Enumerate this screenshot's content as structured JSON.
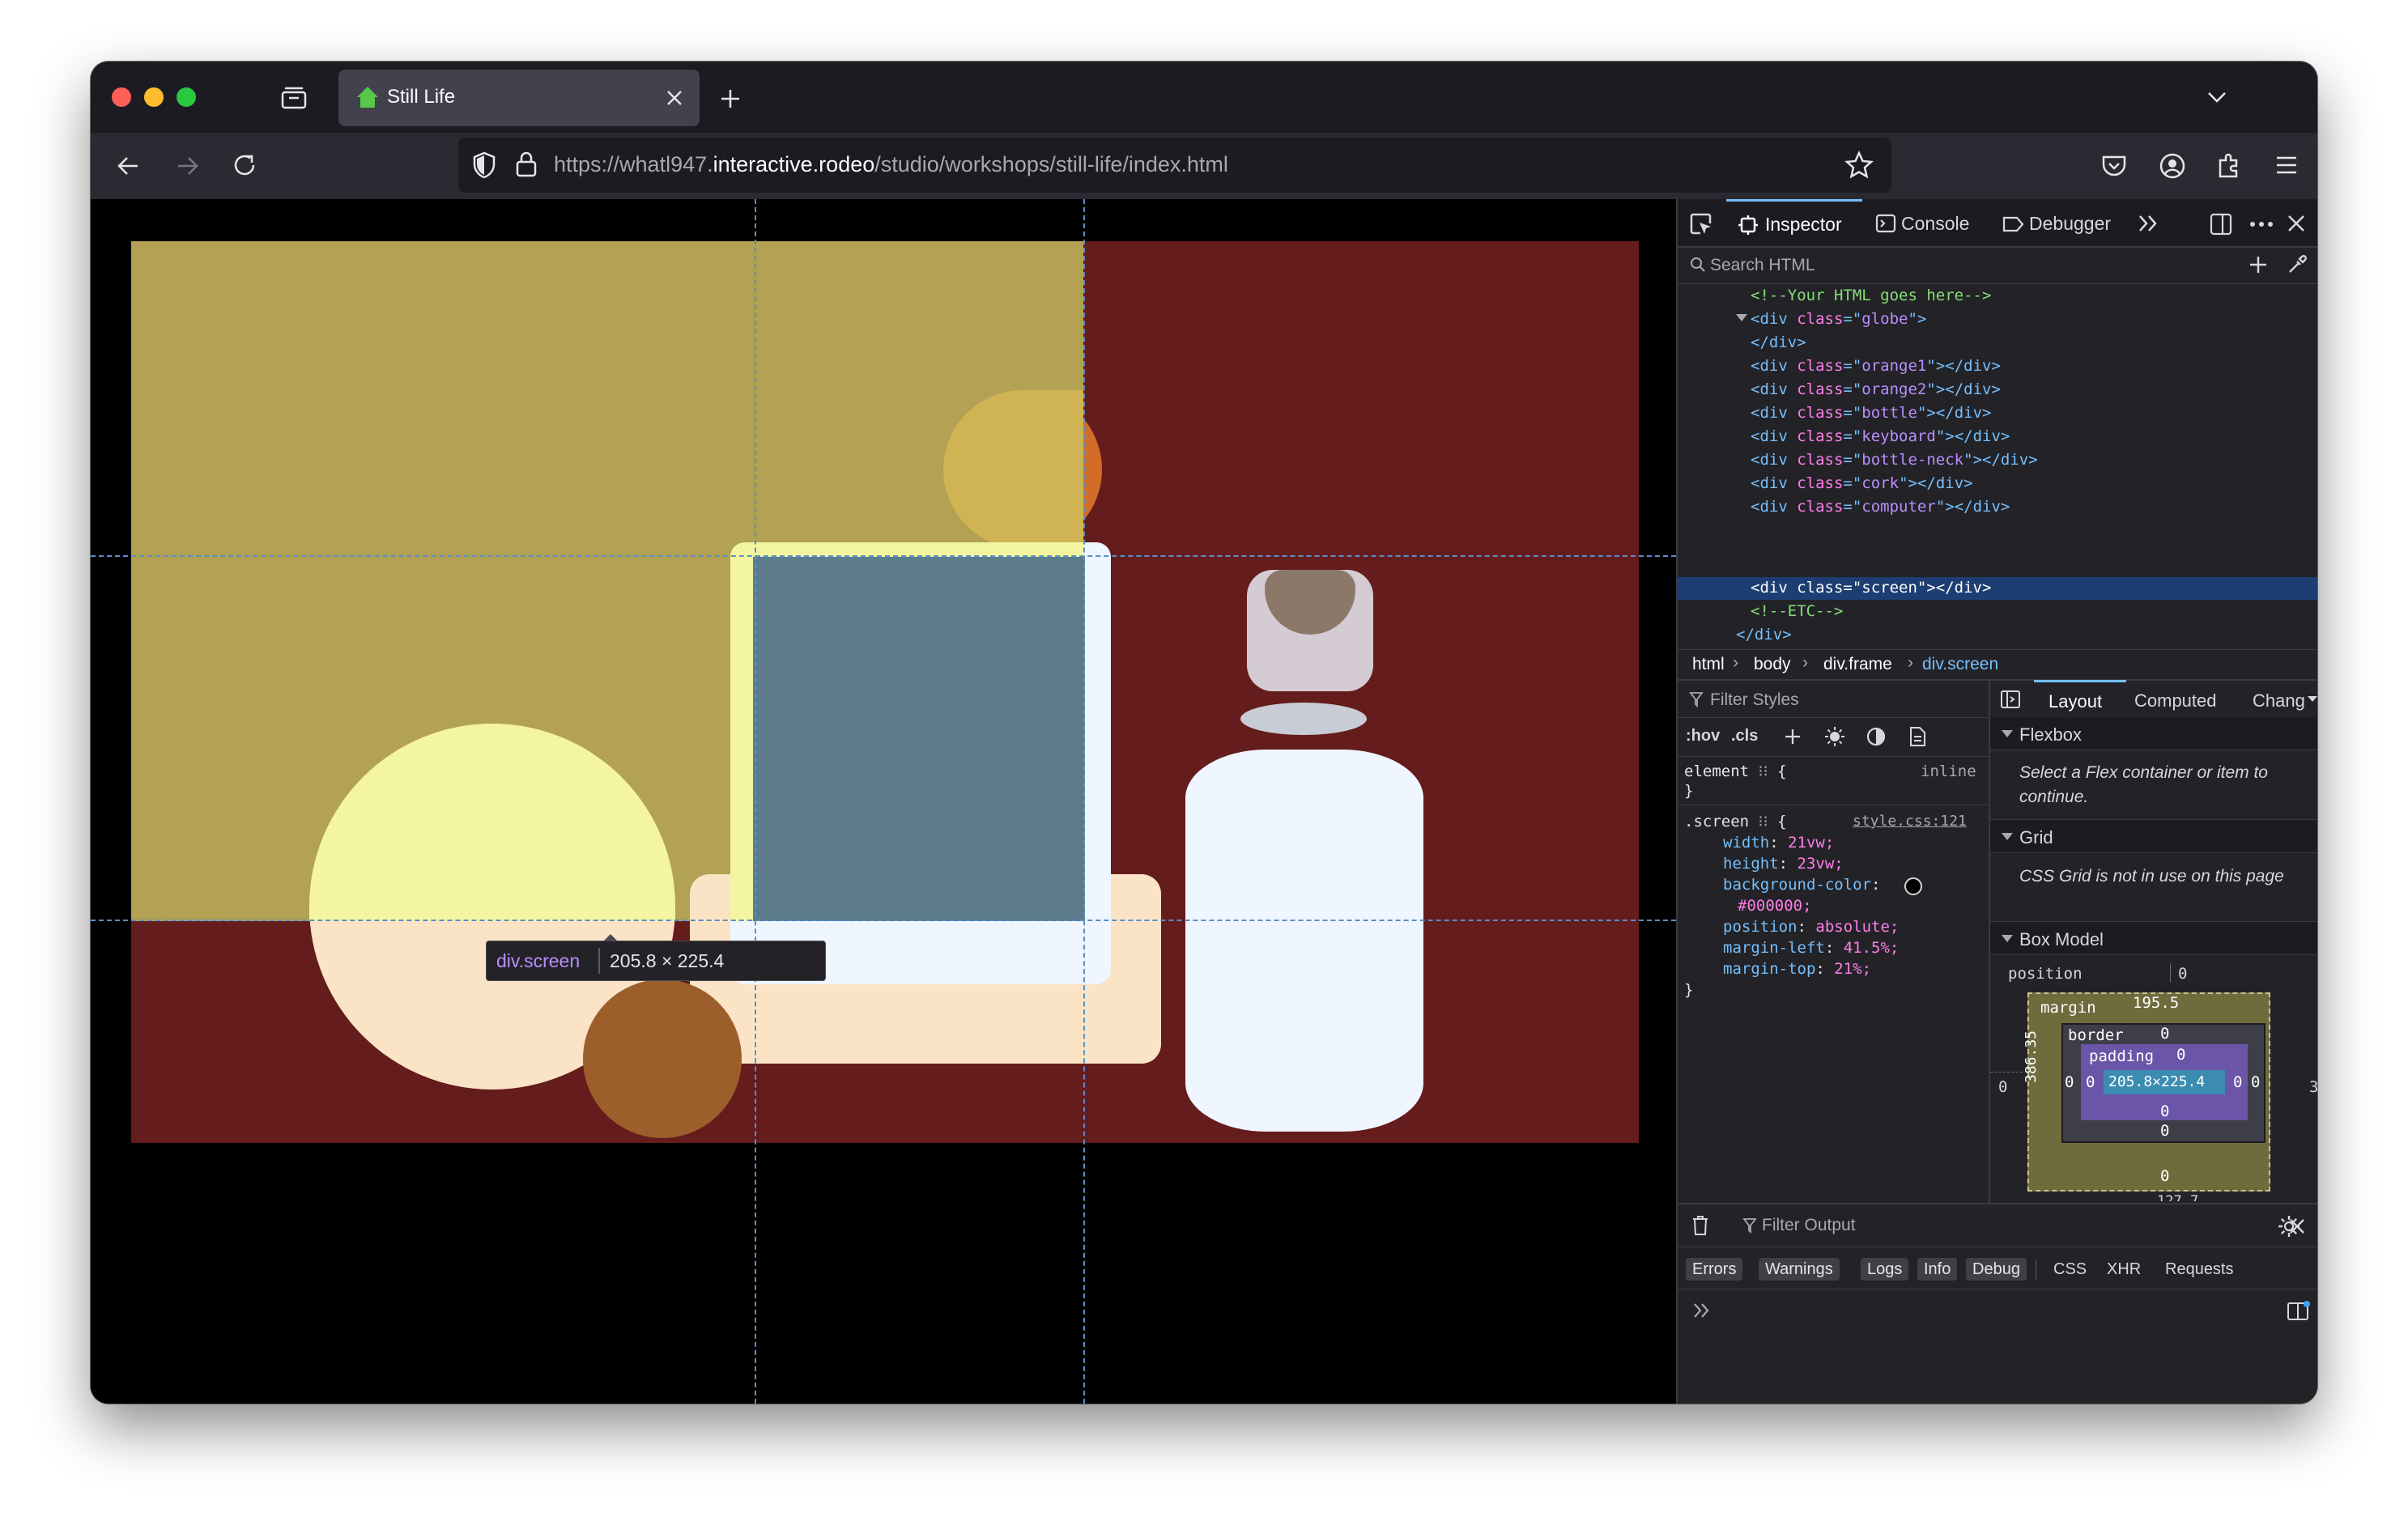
{
  "browser": {
    "tab_title": "Still Life",
    "url_prefix": "https://whatl947.",
    "url_domain": "interactive.rodeo",
    "url_path": "/studio/workshops/still-life/index.html"
  },
  "tooltip": {
    "selector": "div.screen",
    "size": "205.8 × 225.4"
  },
  "devtools": {
    "tabs": [
      "Inspector",
      "Console",
      "Debugger"
    ],
    "search_placeholder": "Search HTML",
    "html_lines": [
      {
        "type": "comment",
        "text": "<!--Your HTML goes here-->"
      },
      {
        "type": "open",
        "cls": "globe"
      },
      {
        "type": "close"
      },
      {
        "type": "div",
        "cls": "orange1"
      },
      {
        "type": "div",
        "cls": "orange2"
      },
      {
        "type": "div",
        "cls": "bottle"
      },
      {
        "type": "div",
        "cls": "keyboard"
      },
      {
        "type": "div",
        "cls": "bottle-neck"
      },
      {
        "type": "div",
        "cls": "cork"
      },
      {
        "type": "div",
        "cls": "computer"
      },
      {
        "type": "div",
        "cls": "screen",
        "selected": true
      },
      {
        "type": "comment",
        "text": "<!--ETC-->"
      },
      {
        "type": "close2"
      }
    ],
    "breadcrumbs": [
      "html",
      "body",
      "div.frame",
      "div.screen"
    ],
    "filter_styles_placeholder": "Filter Styles",
    "hov_label": ":hov",
    "cls_label": ".cls",
    "rules": {
      "element_selector": "element",
      "element_origin": "inline",
      "screen_selector": ".screen",
      "screen_source": "style.css:121",
      "declarations": [
        {
          "prop": "width",
          "value": "21vw;"
        },
        {
          "prop": "height",
          "value": "23vw;"
        },
        {
          "prop": "background-color",
          "value": ""
        },
        {
          "prop": "",
          "value": "#000000;"
        },
        {
          "prop": "position",
          "value": "absolute;"
        },
        {
          "prop": "margin-left",
          "value": "41.5%;"
        },
        {
          "prop": "margin-top",
          "value": "21%;"
        }
      ]
    },
    "layout_tabs": [
      "Layout",
      "Computed",
      "Chang"
    ],
    "flexbox": {
      "title": "Flexbox",
      "message": "Select a Flex container or item to continue."
    },
    "grid": {
      "title": "Grid",
      "message": "CSS Grid is not in use on this page"
    },
    "box_model": {
      "title": "Box Model",
      "position_label": "position",
      "position_value": "0",
      "margin_label": "margin",
      "margin_top": "195.5",
      "margin_left": "386.35",
      "outer_left": "0",
      "outer_right": "3",
      "border_label": "border",
      "border_top": "0",
      "padding_label": "padding",
      "padding_top": "0",
      "content_size": "205.8×225.4",
      "zero": "0",
      "margin_bottom_cut": "127.7"
    },
    "console": {
      "filter_placeholder": "Filter Output",
      "filters": [
        "Errors",
        "Warnings",
        "Logs",
        "Info",
        "Debug"
      ],
      "categories": [
        "CSS",
        "XHR",
        "Requests"
      ]
    }
  },
  "colors": {
    "wall_left": "#b3a154",
    "wall_right": "#651c1c",
    "screen": "#5c7b8b",
    "highlight_yellow": "#f3f5a0",
    "inspector_blue": "#5a8fc8",
    "selected_row": "#1d3e72"
  }
}
